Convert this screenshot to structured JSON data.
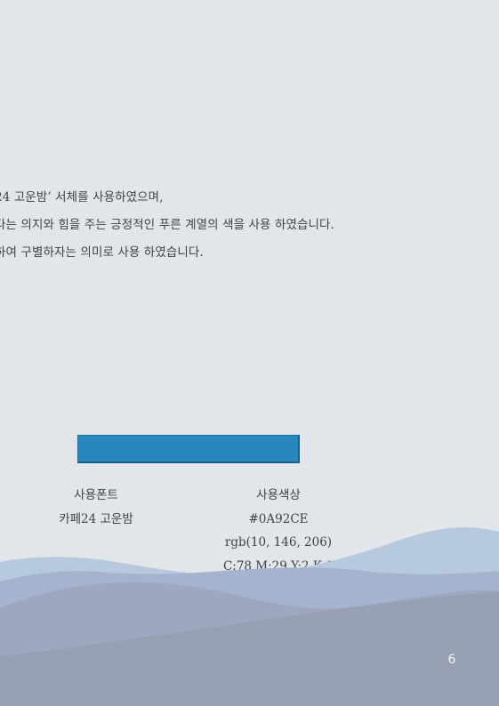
{
  "body_text": {
    "lines": [
      "24 고운밤’ 서체를 사용하였으며,",
      "다는 의지와 힘을 주는 긍정적인 푸른 계열의 색을 사용 하였습니다.",
      "하여 구별하자는 의미로 사용 하였습니다."
    ]
  },
  "font_info": {
    "heading": "사용폰트",
    "value": "카페24 고운밤"
  },
  "color_info": {
    "heading": "사용색상",
    "hex": "#0A92CE",
    "rgb": "rgb(10, 146, 206)",
    "cmyk": "C:78 M:29 Y:2 K:0"
  },
  "colors": {
    "swatch": "#2888bd",
    "background": "#e2e6ea"
  },
  "page_number": "6"
}
